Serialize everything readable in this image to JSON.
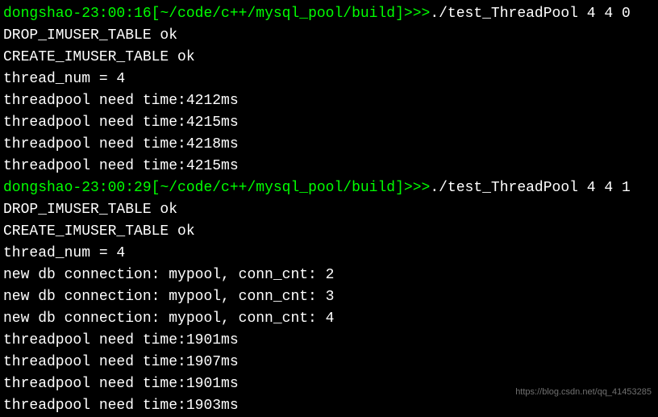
{
  "terminal": {
    "lines": [
      {
        "type": "prompt",
        "user": "dongshao-23:00:16",
        "path": "[~/code/c++/mysql_pool/build]",
        "arrows": ">>>",
        "command": "./test_ThreadPool 4 4 0"
      },
      {
        "type": "output",
        "text": "DROP_IMUSER_TABLE ok"
      },
      {
        "type": "output",
        "text": "CREATE_IMUSER_TABLE ok"
      },
      {
        "type": "output",
        "text": "thread_num = 4"
      },
      {
        "type": "output",
        "text": "threadpool need time:4212ms"
      },
      {
        "type": "output",
        "text": "threadpool need time:4215ms"
      },
      {
        "type": "output",
        "text": "threadpool need time:4218ms"
      },
      {
        "type": "output",
        "text": "threadpool need time:4215ms"
      },
      {
        "type": "prompt",
        "user": "dongshao-23:00:29",
        "path": "[~/code/c++/mysql_pool/build]",
        "arrows": ">>>",
        "command": "./test_ThreadPool 4 4 1"
      },
      {
        "type": "output",
        "text": "DROP_IMUSER_TABLE ok"
      },
      {
        "type": "output",
        "text": "CREATE_IMUSER_TABLE ok"
      },
      {
        "type": "output",
        "text": "thread_num = 4"
      },
      {
        "type": "output",
        "text": "new db connection: mypool, conn_cnt: 2"
      },
      {
        "type": "output",
        "text": "new db connection: mypool, conn_cnt: 3"
      },
      {
        "type": "output",
        "text": "new db connection: mypool, conn_cnt: 4"
      },
      {
        "type": "output",
        "text": "threadpool need time:1901ms"
      },
      {
        "type": "output",
        "text": "threadpool need time:1907ms"
      },
      {
        "type": "output",
        "text": "threadpool need time:1901ms"
      },
      {
        "type": "output",
        "text": "threadpool need time:1903ms"
      }
    ]
  },
  "watermark": "https://blog.csdn.net/qq_41453285"
}
